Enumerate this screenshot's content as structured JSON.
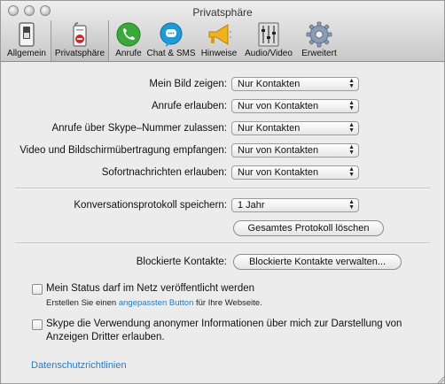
{
  "window": {
    "title": "Privatsphäre"
  },
  "toolbar": {
    "items": [
      {
        "label": "Allgemein",
        "icon": "switch-icon"
      },
      {
        "label": "Privatsphäre",
        "icon": "privacy-sign-icon",
        "selected": true
      },
      {
        "label": "Anrufe",
        "icon": "phone-icon"
      },
      {
        "label": "Chat & SMS",
        "icon": "chat-bubble-icon"
      },
      {
        "label": "Hinweise",
        "icon": "megaphone-icon"
      },
      {
        "label": "Audio/Video",
        "icon": "mixer-icon"
      },
      {
        "label": "Erweitert",
        "icon": "gear-icon"
      }
    ]
  },
  "settings": {
    "picture": {
      "label": "Mein Bild zeigen:",
      "value": "Nur Kontakten"
    },
    "calls": {
      "label": "Anrufe erlauben:",
      "value": "Nur von Kontakten"
    },
    "skype_number": {
      "label": "Anrufe über Skype–Nummer zulassen:",
      "value": "Nur Kontakten"
    },
    "video": {
      "label": "Video und Bildschirmübertragung empfangen:",
      "value": "Nur von Kontakten"
    },
    "messages": {
      "label": "Sofortnachrichten erlauben:",
      "value": "Nur von Kontakten"
    }
  },
  "history": {
    "label": "Konversationsprotokoll speichern:",
    "value": "1 Jahr",
    "clear_button": "Gesamtes Protokoll löschen"
  },
  "blocked": {
    "label": "Blockierte Kontakte:",
    "button": "Blockierte Kontakte verwalten..."
  },
  "online_status": {
    "label": "Mein Status darf im Netz veröffentlicht werden",
    "checked": false,
    "hint_before": "Erstellen Sie einen ",
    "hint_link": "angepassten Button",
    "hint_after": " für Ihre Webseite."
  },
  "anonymous_info": {
    "label_line1": "Skype die Verwendung anonymer Informationen über mich zur Darstellung von",
    "label_line2": "Anzeigen Dritter erlauben.",
    "checked": false
  },
  "footer": {
    "privacy_link": "Datenschutzrichtlinien"
  },
  "colors": {
    "link": "#2b7bbd",
    "selected_tab": "#bdbdbd"
  }
}
